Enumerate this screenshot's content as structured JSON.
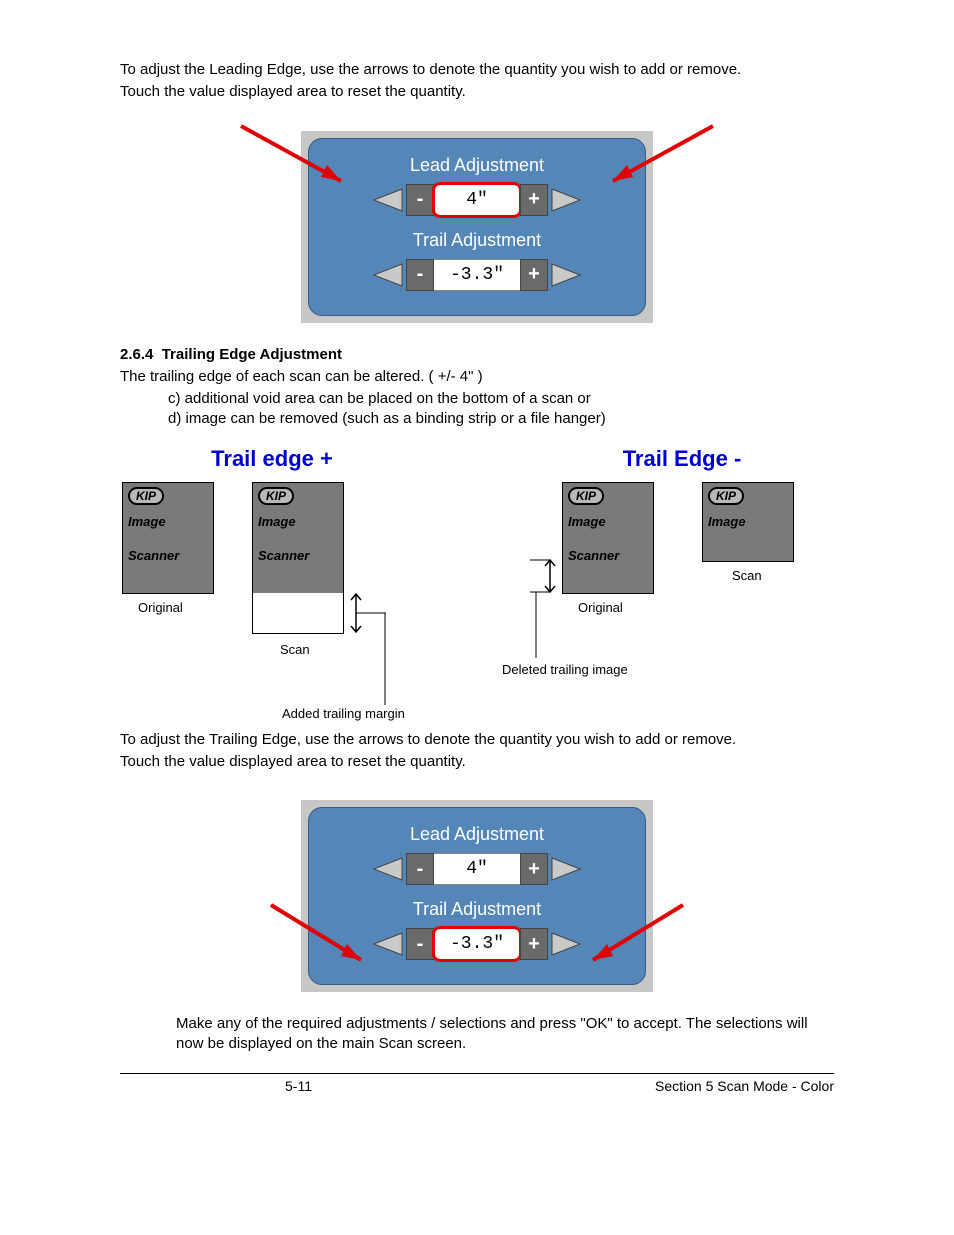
{
  "intro": {
    "p1": "To adjust the Leading Edge, use the arrows to denote the quantity you wish to add or remove.",
    "p2": "Touch the value displayed area to reset the quantity."
  },
  "panel1": {
    "lead_label": "Lead Adjustment",
    "trail_label": "Trail Adjustment",
    "lead_value": "4\"",
    "trail_value": "-3.3\"",
    "minus": "-",
    "plus": "+"
  },
  "section": {
    "num": "2.6.4",
    "title": "Trailing Edge Adjustment",
    "line": "The trailing edge of each scan can be altered. ( +/- 4\" )",
    "c": "c)  additional void area can be placed on the bottom of a scan or",
    "d": "d)  image can be removed (such as a binding strip or a file hanger)"
  },
  "diagrams": {
    "left_title": "Trail edge +",
    "right_title": "Trail Edge -",
    "kip": "KIP",
    "image": "Image",
    "scanner": "Scanner",
    "original": "Original",
    "scan": "Scan",
    "added": "Added trailing margin",
    "deleted": "Deleted trailing image"
  },
  "intro2": {
    "p1": "To adjust the Trailing Edge, use the arrows to denote the quantity you wish to add or remove.",
    "p2": "Touch the value displayed area to reset the quantity."
  },
  "panel2": {
    "lead_label": "Lead Adjustment",
    "trail_label": "Trail Adjustment",
    "lead_value": "4\"",
    "trail_value": "-3.3\"",
    "minus": "-",
    "plus": "+"
  },
  "conclude": "Make any of the required adjustments / selections and press \"OK\" to accept. The selections will now be displayed on the main Scan screen.",
  "footer": {
    "page": "5-11",
    "section": "Section 5    Scan Mode - Color"
  }
}
